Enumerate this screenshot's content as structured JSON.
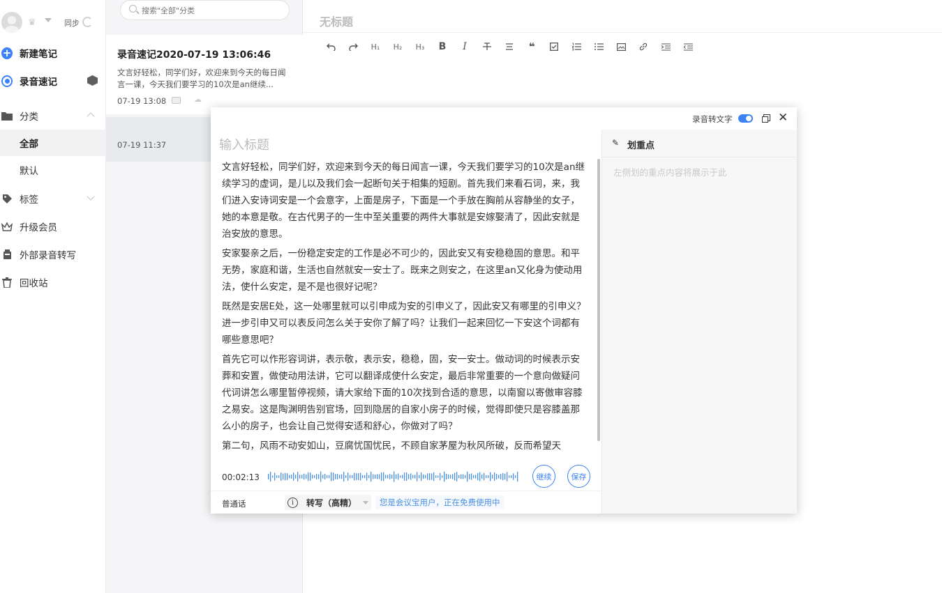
{
  "sidebar": {
    "sync_label": "同步",
    "new_note": "新建笔记",
    "quick_record": "录音速记",
    "category_header": "分类",
    "categories": [
      "全部",
      "默认"
    ],
    "tags": "标签",
    "upgrade": "升级会员",
    "external_transcribe": "外部录音转写",
    "recycle_bin": "回收站"
  },
  "notelist": {
    "search_placeholder": "搜索\"全部\"分类",
    "notes": [
      {
        "title": "录音速记2020-07-19 13:06:46",
        "snippet": "文言好轻松，同学们好，欢迎来到今天的每日闻言一课，今天我们要学习的10次是an继续...",
        "time": "07-19 13:08"
      },
      {
        "time": "07-19 11:37"
      }
    ]
  },
  "editor": {
    "title": "无标题",
    "toolbar": [
      "undo",
      "redo",
      "H1",
      "H2",
      "H3",
      "B",
      "I",
      "strikethrough",
      "align",
      "quote",
      "checkbox",
      "ordered-list",
      "bullet-list",
      "image",
      "link",
      "indent",
      "outdent"
    ],
    "toolbar_labels": {
      "h1": "H₁",
      "h2": "H₂",
      "h3": "H₃",
      "bold": "B",
      "italic": "I"
    }
  },
  "dialog": {
    "rtt_label": "录音转文字",
    "rtt_enabled": true,
    "title_placeholder": "输入标题",
    "paragraphs": [
      "文言好轻松，同学们好，欢迎来到今天的每日闻言一课，今天我们要学习的10次是an继续学习的虚词，是儿以及我们会一起断句关于相集的短剧。首先我们来看石词，来，我们进入安诗词安是一个会意字，上面是房子，下面是一个手放在胸前从容静坐的女子，她的本意是敬。在古代男子的一生中至关重要的两件大事就是安嫁娶清了，因此安就是治安放的意思。",
      "安家娶亲之后，一份稳定安定的工作是必不可少的，因此安又有安稳稳固的意思。和平无势，家庭和谐，生活也自然就安一安士了。既来之则安之，在这里an又化身为使动用法，使什么安定，是不是也很好记呢？",
      "既然是安居E处，这一处哪里就可以引申成为安的引申义了，因此安又有哪里的引申义？进一步引申又可以表反问怎么关于安你了解了吗？让我们一起来回忆一下安这个词都有哪些意思吧？",
      "首先它可以作形容词讲，表示敬，表示安，稳稳，固，安一安士。做动词的时候表示安葬和安置，做使动用法讲，它可以翻译成使什么安定，最后非常重要的一个意向做疑问代词讲怎么哪里暂停视频，请大家给下面的10次找到合适的意思，以南窗以寄傲审容膝之易安。这是陶渊明告别官场，回到隐居的自家小房子的时候，觉得即使只是容膝盖那么小的房子，也会让自己觉得安适和舒心，你做对了吗？",
      "第二句，风雨不动安如山，豆腐忧国忧民，不顾自家茅屋为秋风所破，反而希望天"
    ],
    "player": {
      "elapsed": "00:02:13",
      "continue_label": "继续",
      "save_label": "保存"
    },
    "status": {
      "language": "普通话",
      "mode_label": "转写（高精）",
      "user_note": "您是会议宝用户，正在免费使用中"
    },
    "highlights": {
      "title": "划重点",
      "hint": "左侧划的重点内容将展示于此"
    }
  },
  "colors": {
    "accent": "#3b82f6",
    "link": "#4a90e2"
  }
}
